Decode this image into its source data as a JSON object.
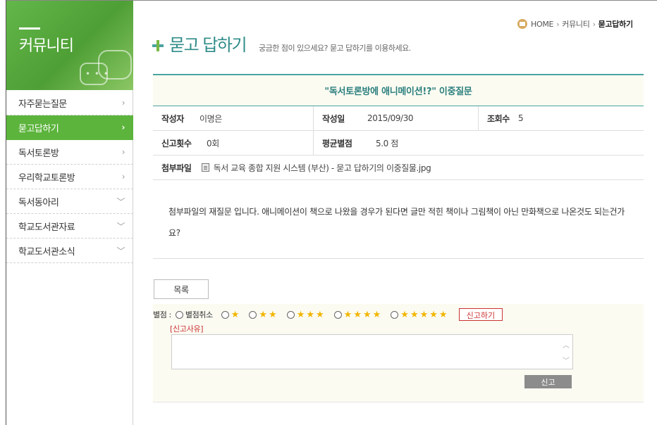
{
  "sidebar": {
    "title": "커뮤니티",
    "items": [
      {
        "label": "자주묻는질문",
        "chevron": "›"
      },
      {
        "label": "묻고답하기",
        "chevron": "›"
      },
      {
        "label": "독서토론방",
        "chevron": "›"
      },
      {
        "label": "우리학교토론방",
        "chevron": "›"
      },
      {
        "label": "독서동아리",
        "chevron": "﹀"
      },
      {
        "label": "학교도서관자료",
        "chevron": "﹀"
      },
      {
        "label": "학교도서관소식",
        "chevron": "﹀"
      }
    ],
    "active_index": 1
  },
  "breadcrumb": {
    "home": "HOME",
    "section": "커뮤니티",
    "current": "묻고답하기",
    "separator": "›"
  },
  "page": {
    "title": "묻고 답하기",
    "subtitle": "궁금한 점이 있으세요? 묻고 답하기를 이용하세요."
  },
  "post": {
    "title": "\"독서토론방에 애니메이션!?\" 이중질문",
    "author_label": "작성자",
    "author": "이명은",
    "date_label": "작성일",
    "date": "2015/09/30",
    "views_label": "조회수",
    "views": "5",
    "reports_label": "신고횟수",
    "reports": "0회",
    "avg_label": "평균별점",
    "avg": "5.0 점",
    "attach_label": "첨부파일",
    "attachment": "독서 교육 종합 지원 시스템 (부산) - 묻고 답하기의 이중질물.jpg",
    "body": "첨부파일의 재질문 입니다. 애니메이션이 책으로 나왔을 경우가 된다면 글만 적힌 책이나 그림책이 아닌 만화책으로 나온것도 되는건가요?"
  },
  "actions": {
    "list_label": "목록"
  },
  "rating": {
    "label": "별점 :",
    "cancel_label": "별점취소",
    "options": [
      "★",
      "★★",
      "★★★",
      "★★★★",
      "★★★★★"
    ],
    "report_label": "신고하기",
    "reason_label": "[신고사유]",
    "submit_label": "신고",
    "star_color": "#f2b500"
  },
  "colors": {
    "accent_green": "#5cb43c",
    "teal": "#2f8c89",
    "report_red": "#cc3333"
  }
}
